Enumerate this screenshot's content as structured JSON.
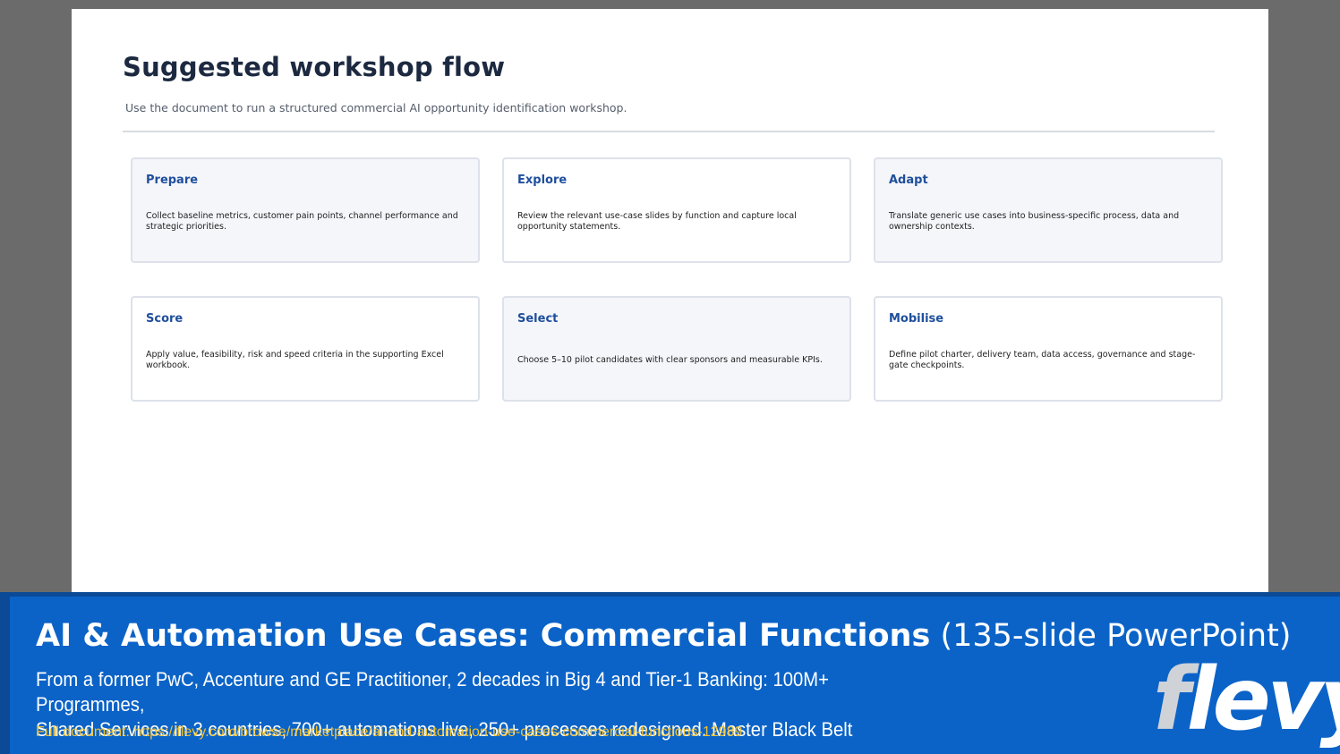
{
  "slide": {
    "title": "Suggested workshop flow",
    "subtitle": "Use the document to run a structured commercial AI opportunity identification workshop.",
    "cards": [
      {
        "title": "Prepare",
        "body": "Collect baseline metrics, customer pain points, channel performance and strategic priorities."
      },
      {
        "title": "Explore",
        "body": "Review the relevant use-case slides by function and capture local opportunity statements."
      },
      {
        "title": "Adapt",
        "body": "Translate generic use cases into business-specific process, data and ownership contexts."
      },
      {
        "title": "Score",
        "body": "Apply value, feasibility, risk and speed criteria in the supporting Excel workbook."
      },
      {
        "title": "Select",
        "body": "Choose 5–10 pilot candidates with clear sponsors and measurable KPIs."
      },
      {
        "title": "Mobilise",
        "body": "Define pilot charter, delivery team, data access, governance and stage-gate checkpoints."
      }
    ]
  },
  "banner": {
    "title_bold": "AI & Automation Use Cases: Commercial Functions",
    "title_light": "(135-slide PowerPoint)",
    "description_line1": "From a former PwC, Accenture and GE Practitioner, 2 decades in Big 4 and Tier-1 Banking: 100M+ Programmes,",
    "description_line2": "Shared Services in 3 countries, 700+ automations live, 250+ processes redesigned. Master Black Belt",
    "link_text": "Full document: https://flevy.com/browse/marketplace/ai-and-automation-use-cases-commercial-functions-12989",
    "logo_first": "f",
    "logo_rest": "levy"
  },
  "colors": {
    "banner_blue": "#0b63c7",
    "card_title_blue": "#1f4f9c",
    "link_yellow": "#f2c12e",
    "slide_title": "#1c2940"
  }
}
